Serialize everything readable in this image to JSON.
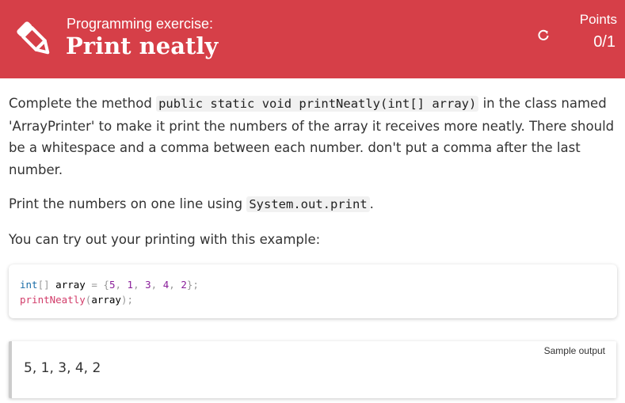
{
  "header": {
    "subtitle": "Programming exercise:",
    "title": "Print neatly",
    "points_label": "Points",
    "points_value": "0/1",
    "icon": "pencil-icon",
    "refresh_icon": "refresh-icon",
    "background_color": "#d63f48"
  },
  "body": {
    "p1_before": "Complete the method ",
    "p1_code": "public static void printNeatly(int[] array)",
    "p1_after": " in the class named 'ArrayPrinter' to make it print the numbers of the array it receives more neatly. There should be a whitespace and a comma between each number. don't put a comma after the last number.",
    "p2_before": "Print the numbers on one line using ",
    "p2_code": "System.out.print",
    "p2_after": ".",
    "p3": "You can try out your printing with this example:"
  },
  "code": {
    "line1": {
      "type": "int",
      "brackets": "[]",
      "var": "array",
      "eq": "=",
      "open": "{",
      "n1": "5",
      "n2": "1",
      "n3": "3",
      "n4": "4",
      "n5": "2",
      "comma": ",",
      "close": "};"
    },
    "line2": {
      "fn": "printNeatly",
      "open": "(",
      "arg": "array",
      "close": ");"
    }
  },
  "sample_output": {
    "label": "Sample output",
    "text": "5, 1, 3, 4, 2"
  }
}
